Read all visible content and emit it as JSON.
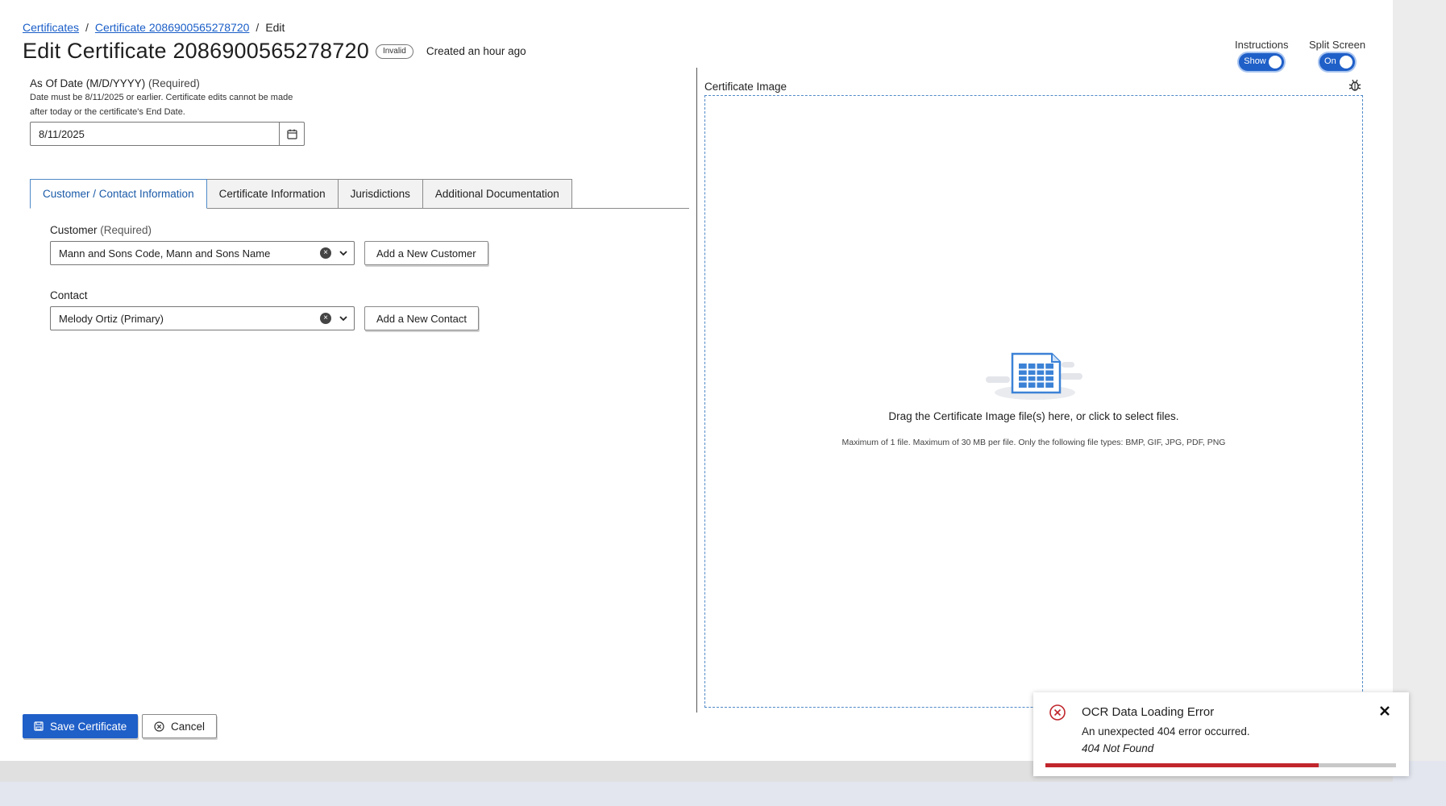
{
  "breadcrumb": {
    "items": [
      {
        "label": "Certificates"
      },
      {
        "label": "Certificate 2086900565278720"
      }
    ],
    "current": "Edit",
    "separator": "/"
  },
  "header": {
    "title": "Edit Certificate 2086900565278720",
    "status_badge": "Invalid",
    "created": "Created an hour ago"
  },
  "toggles": {
    "instructions": {
      "label": "Instructions",
      "state": "Show",
      "on": true
    },
    "split_screen": {
      "label": "Split Screen",
      "state": "On",
      "on": true
    }
  },
  "as_of_date": {
    "label": "As Of Date (M/D/YYYY)",
    "required": "(Required)",
    "help": "Date must be 8/11/2025 or earlier. Certificate edits cannot be made after today or the certificate's End Date.",
    "value": "8/11/2025",
    "icon": "calendar-icon"
  },
  "tabs": [
    {
      "label": "Customer / Contact Information",
      "active": true
    },
    {
      "label": "Certificate Information",
      "active": false
    },
    {
      "label": "Jurisdictions",
      "active": false
    },
    {
      "label": "Additional Documentation",
      "active": false
    }
  ],
  "customer": {
    "label": "Customer",
    "required": "(Required)",
    "value": "Mann and Sons Code, Mann and Sons Name",
    "add_button": "Add a New Customer"
  },
  "contact": {
    "label": "Contact",
    "value": "Melody Ortiz (Primary)",
    "add_button": "Add a New Contact"
  },
  "certificate_image": {
    "label": "Certificate Image",
    "drop_text": "Drag the Certificate Image file(s) here, or click to select files.",
    "limits_text": "Maximum of 1 file. Maximum of 30 MB per file. Only the following file types: BMP, GIF, JPG, PDF, PNG",
    "icon": "bug-icon"
  },
  "actions": {
    "save": "Save Certificate",
    "cancel": "Cancel"
  },
  "toast": {
    "title": "OCR Data Loading Error",
    "message": "An unexpected 404 error occurred.",
    "detail": "404 Not Found",
    "progress": 0.78
  },
  "colors": {
    "primary": "#1f5fc8",
    "error": "#c0262c",
    "link": "#1a5ec8",
    "active_tab": "#1a5aa8"
  }
}
